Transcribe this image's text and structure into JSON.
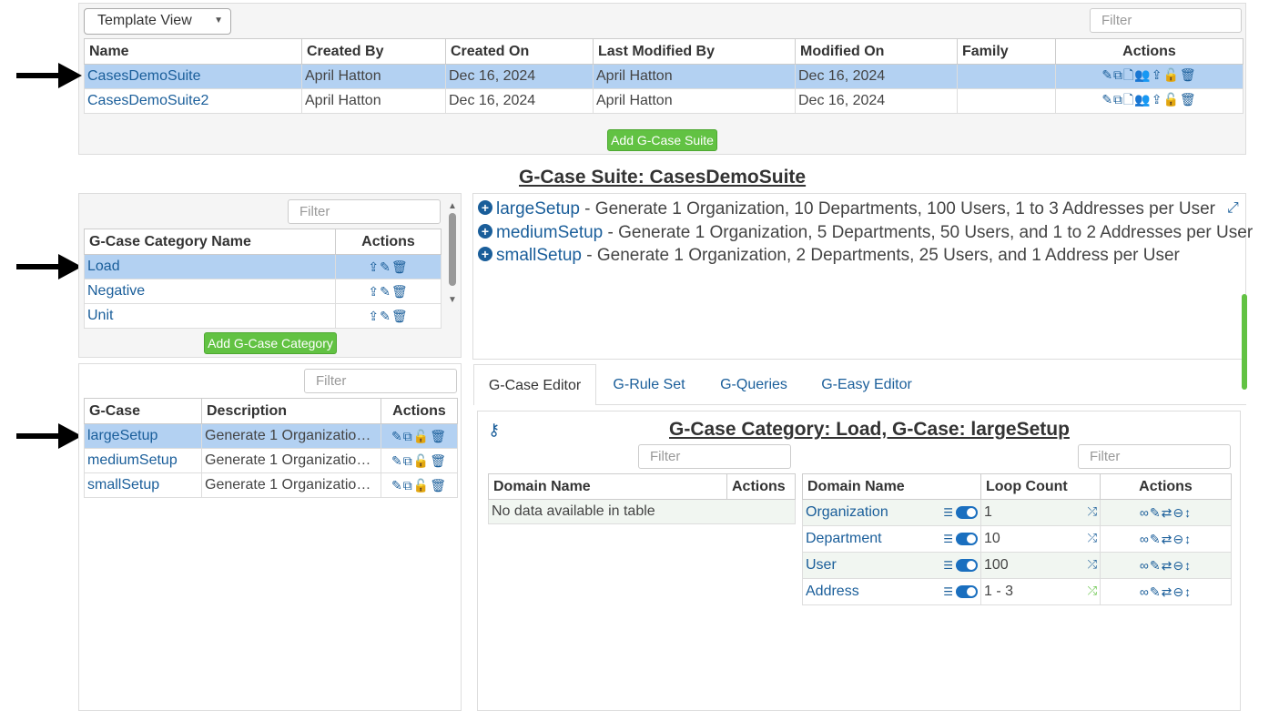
{
  "suites": {
    "view_select": "Template View",
    "filter_placeholder": "Filter",
    "columns": [
      "Name",
      "Created By",
      "Created On",
      "Last Modified By",
      "Modified On",
      "Family",
      "Actions"
    ],
    "rows": [
      {
        "name": "CasesDemoSuite",
        "created_by": "April Hatton",
        "created_on": "Dec 16, 2024",
        "modified_by": "April Hatton",
        "modified_on": "Dec 16, 2024",
        "family": "",
        "actions": "✎⧉🗋👥⇪🔓🗑"
      },
      {
        "name": "CasesDemoSuite2",
        "created_by": "April Hatton",
        "created_on": "Dec 16, 2024",
        "modified_by": "April Hatton",
        "modified_on": "Dec 16, 2024",
        "family": "",
        "actions": "✎⧉🗋👥⇪🔓🗑"
      }
    ],
    "add_button": "Add G-Case Suite"
  },
  "suite_title": "G-Case Suite: CasesDemoSuite",
  "categories": {
    "filter_placeholder": "Filter",
    "columns": [
      "G-Case Category Name",
      "Actions"
    ],
    "rows": [
      {
        "name": "Load",
        "actions": "⇪✎🗑"
      },
      {
        "name": "Negative",
        "actions": "⇪✎🗑"
      },
      {
        "name": "Unit",
        "actions": "⇪✎🗑"
      }
    ],
    "add_button": "Add G-Case Category"
  },
  "gcases": {
    "filter_placeholder": "Filter",
    "columns": [
      "G-Case",
      "Description",
      "Actions"
    ],
    "rows": [
      {
        "name": "largeSetup",
        "description": "Generate 1 Organization, 10 Departments, 100 Users, 1 to 3 Addresses per User",
        "actions": "✎⧉🔓🗑"
      },
      {
        "name": "mediumSetup",
        "description": "Generate 1 Organization, 5 Departments, 50 Users, and 1 to 2 Addresses per User",
        "actions": "✎⧉🔓🗑"
      },
      {
        "name": "smallSetup",
        "description": "Generate 1 Organization, 2 Departments, 25 Users, and 1 Address per User",
        "actions": "✎⧉🔓🗑"
      }
    ]
  },
  "setups": [
    {
      "name": "largeSetup",
      "desc": " - Generate 1 Organization, 10 Departments, 100 Users, 1 to 3 Addresses per User"
    },
    {
      "name": "mediumSetup",
      "desc": " - Generate 1 Organization, 5 Departments, 50 Users, and 1 to 2 Addresses per User"
    },
    {
      "name": "smallSetup",
      "desc": " - Generate 1 Organization, 2 Departments, 25 Users, and 1 Address per User"
    }
  ],
  "tabs": [
    "G-Case Editor",
    "G-Rule Set",
    "G-Queries",
    "G-Easy Editor"
  ],
  "editor": {
    "title": "G-Case Category: Load, G-Case: largeSetup",
    "filter_placeholder": "Filter",
    "left_columns": [
      "Domain Name",
      "Actions"
    ],
    "empty_text": "No data available in table",
    "right_columns": [
      "Domain Name",
      "Loop Count",
      "Actions"
    ],
    "rows": [
      {
        "name": "Organization",
        "count": "1"
      },
      {
        "name": "Department",
        "count": "10"
      },
      {
        "name": "User",
        "count": "100"
      },
      {
        "name": "Address",
        "count": "1 - 3"
      }
    ],
    "row_actions": "∞✎⇄⊖↕"
  }
}
